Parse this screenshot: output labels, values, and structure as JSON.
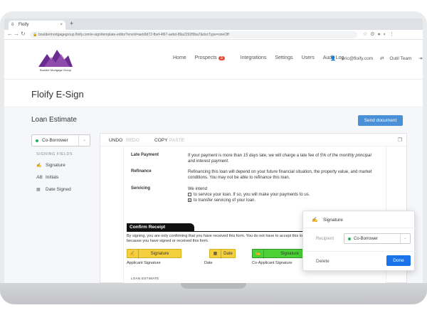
{
  "browser": {
    "tab_title": "Floify",
    "url": "bouldermortgagegroup.floify.com/e-sign/template-editor?envId=aeb9d72-fbef-4f67-aebd-89a2292f0ba7&docType=oneOff"
  },
  "header": {
    "logo_text": "Boulder Mortgage Group",
    "nav": [
      "Home",
      "Prospects",
      "Integrations",
      "Settings",
      "Users",
      "Audit Log"
    ],
    "prospects_badge": "3",
    "user_email": "eric@floify.com",
    "team_label": "Outil Team"
  },
  "page": {
    "title": "Floify E-Sign",
    "doc_title": "Loan Estimate",
    "send_label": "Send document"
  },
  "sidebar": {
    "role": "Co-Borrower",
    "role_color": "#27ae60",
    "fields_heading": "SIGNING FIELDS",
    "items": [
      {
        "label": "Signature",
        "icon": "signature-icon"
      },
      {
        "label": "Initials",
        "icon": "initials-icon"
      },
      {
        "label": "Date Signed",
        "icon": "calendar-icon"
      }
    ]
  },
  "toolbar": {
    "undo": "UNDO",
    "redo": "REDO",
    "copy": "COPY",
    "paste": "PASTE"
  },
  "doc": {
    "late_payment_label": "Late Payment",
    "late_payment_text_a": "If your payment is more than ",
    "late_payment_text_b": "15 days",
    "late_payment_text_c": " late, we will charge a late fee of ",
    "late_payment_text_d": "5% of the monthly principal and interest payment.",
    "refinance_label": "Refinance",
    "refinance_text": "Refinancing this loan will depend on your future financial situation, the property value, and market conditions. You may not be able to refinance this loan.",
    "servicing_label": "Servicing",
    "servicing_intro": "We intend",
    "servicing_opt1": "to service your loan. If so, you will make your payments to us.",
    "servicing_opt2": "to transfer servicing of your loan.",
    "confirm_heading": "Confirm Receipt",
    "confirm_text": "By signing, you are only confirming that you have received this form. You do not have to accept this loan because you have signed or received this form.",
    "field_signature": "Signature",
    "field_date": "Date",
    "field_co_signature": "Co-Applicant Signature",
    "lbl_applicant": "Applicant Signature",
    "lbl_date": "Date",
    "lbl_coapplicant": "Co-Applicant Signature",
    "footer": "LOAN ESTIMATE"
  },
  "popup": {
    "title": "Signature",
    "recipient_label": "Recipient",
    "recipient_value": "Co-Borrower",
    "delete_label": "Delete",
    "done_label": "Done"
  },
  "colors": {
    "accent": "#4a90d9",
    "done": "#1a73e8",
    "field_yellow": "#f4d03f",
    "field_green": "#4cd137"
  }
}
